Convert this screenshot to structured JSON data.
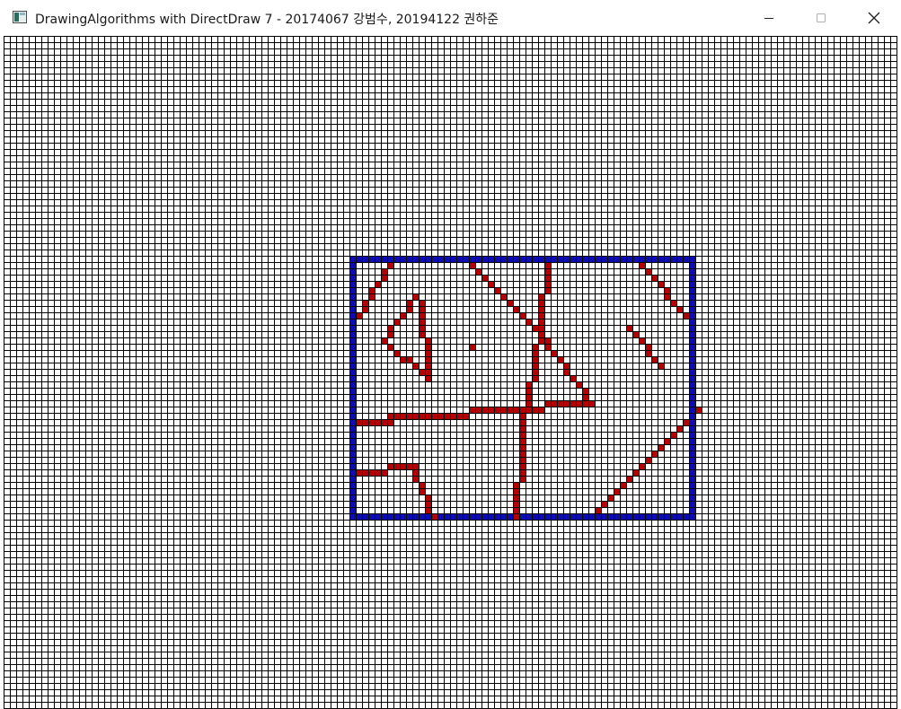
{
  "window": {
    "title": "DrawingAlgorithms with DirectDraw 7 - 20174067 강범수, 20194122 권하준",
    "icon": "app-window-icon",
    "controls": [
      "minimize",
      "maximize",
      "close"
    ]
  },
  "canvas": {
    "grid_color": "#000000",
    "background": "#ffffff",
    "pixel_grid_cell": "7px",
    "rectangle_color": "#0c0cb0",
    "line_color": "#b40000"
  }
}
